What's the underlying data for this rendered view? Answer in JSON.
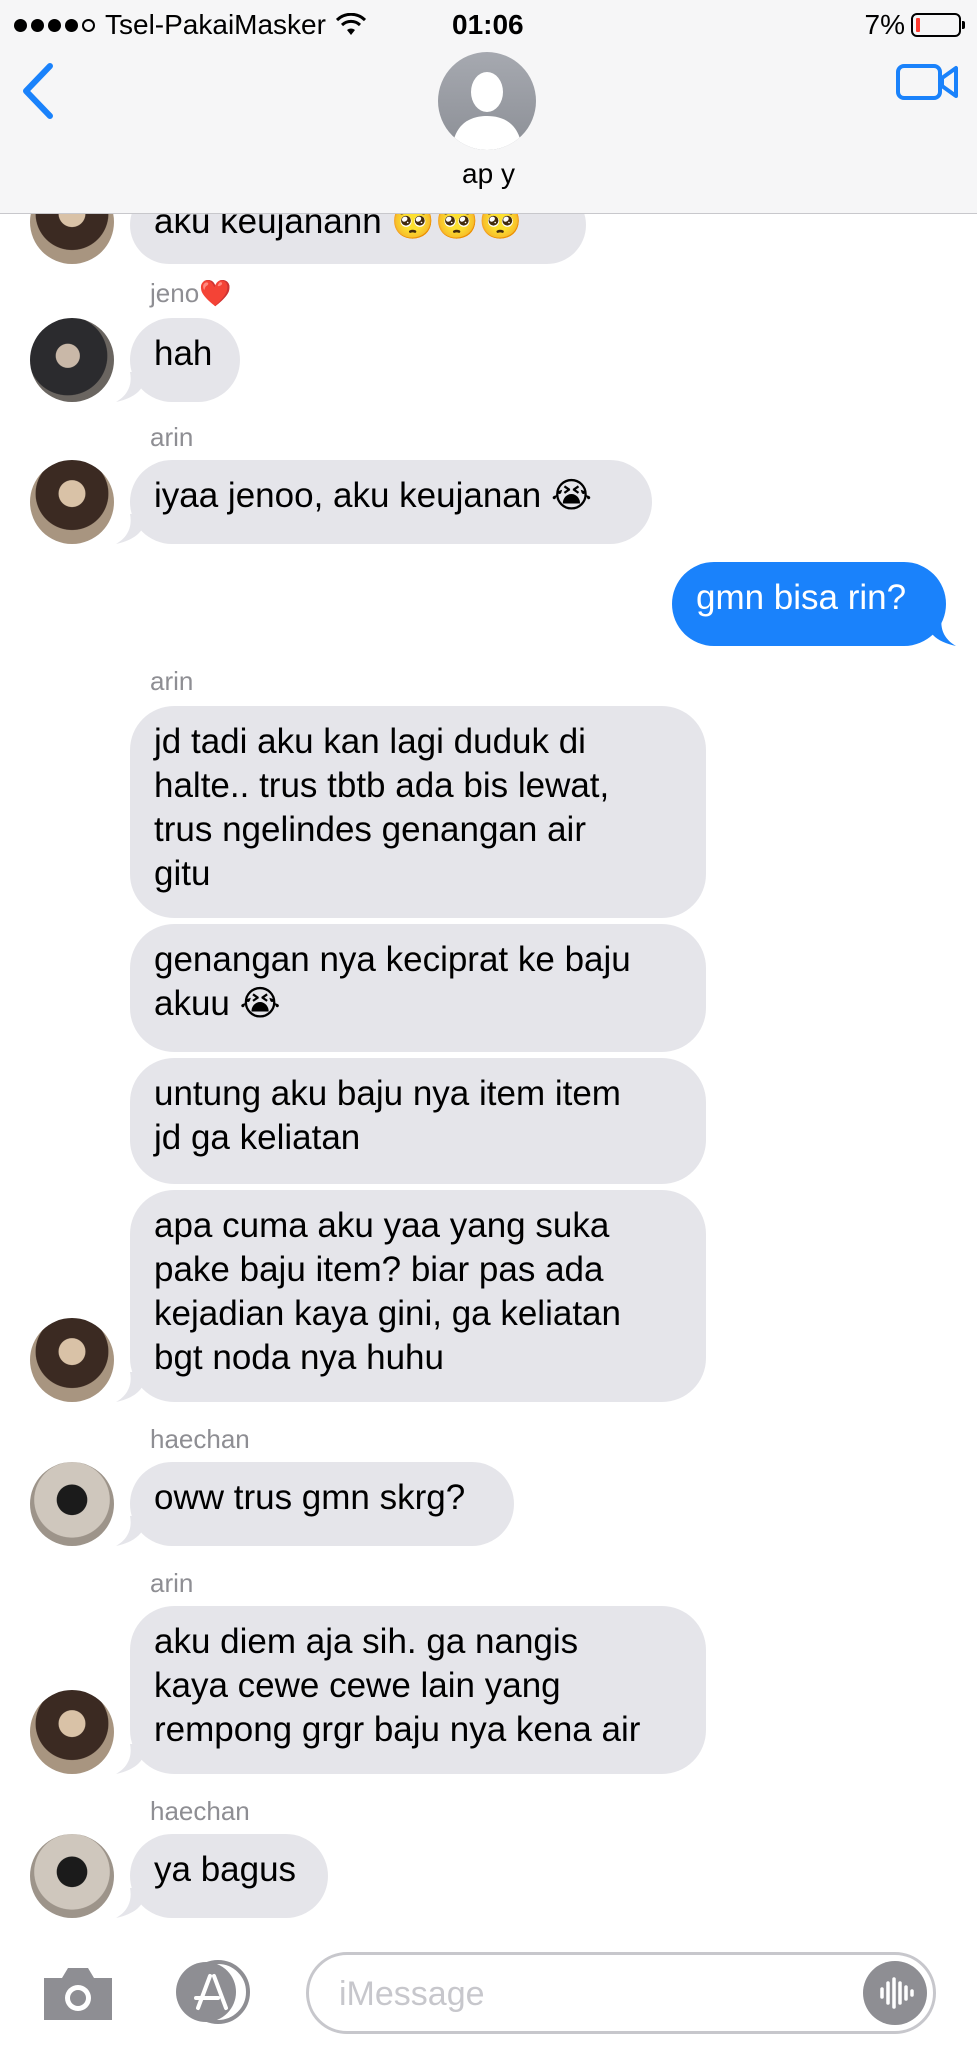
{
  "status_bar": {
    "carrier": "Tsel-PakaiMasker",
    "time": "01:06",
    "battery": "7%"
  },
  "header": {
    "contact_name": "ap y"
  },
  "messages": {
    "partial": "aku keujananh 🥺🥺🥺",
    "sender_jeno": "jeno❤️",
    "m1": "hah",
    "sender_arin_1": "arin",
    "m2": "iyaa jenoo, aku keujanan 😭",
    "m3": "gmn bisa rin?",
    "sender_arin_2": "arin",
    "m4": "jd tadi aku kan lagi duduk di\nhalte.. trus tbtb ada bis lewat,\ntrus ngelindes genangan air\ngitu",
    "m5": "genangan nya keciprat ke baju\nakuu 😭",
    "m6": "untung aku baju nya item item\njd ga keliatan",
    "m7": "apa cuma aku yaa yang suka\npake baju item? biar pas ada\nkejadian kaya gini, ga keliatan\nbgt noda nya huhu",
    "sender_haechan_1": "haechan",
    "m8": "oww trus gmn skrg?",
    "sender_arin_3": "arin",
    "m9": "aku diem aja sih. ga nangis\nkaya cewe cewe lain yang\nrempong grgr baju nya kena air",
    "sender_haechan_2": "haechan",
    "m10": "ya bagus"
  },
  "input": {
    "placeholder": "iMessage"
  },
  "colors": {
    "outgoing": "#1a82fb",
    "incoming": "#e5e5ea",
    "accent": "#1a82fb"
  },
  "icons": [
    "back-icon",
    "video-call-icon",
    "camera-icon",
    "app-store-icon",
    "audio-message-icon"
  ]
}
